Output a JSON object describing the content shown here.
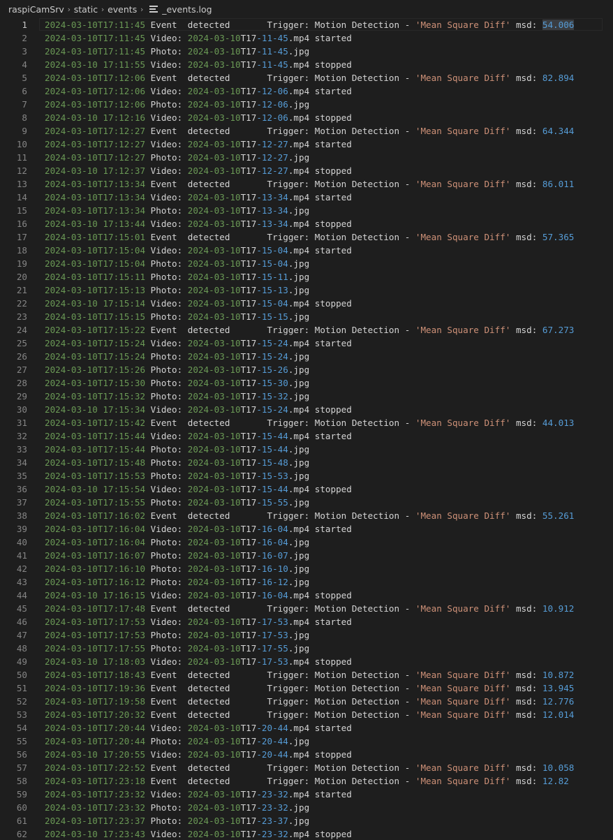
{
  "breadcrumb": {
    "items": [
      "raspiCamSrv",
      "static",
      "events"
    ],
    "file": "_events.log"
  },
  "editor": {
    "active_line": 1,
    "selection_text": "54.006",
    "lines": [
      {
        "n": "1",
        "ts": "2024-03-10T17:11:45",
        "kind": "event",
        "msd": "54.006"
      },
      {
        "n": "2",
        "ts": "2024-03-10T17:11:45",
        "kind": "video",
        "stem": "2024-03-10T17-11-45",
        "status": "started"
      },
      {
        "n": "3",
        "ts": "2024-03-10T17:11:45",
        "kind": "photo",
        "stem": "2024-03-10T17-11-45"
      },
      {
        "n": "4",
        "ts": "2024-03-10 17:11:55",
        "kind": "video",
        "stem": "2024-03-10T17-11-45",
        "status": "stopped"
      },
      {
        "n": "5",
        "ts": "2024-03-10T17:12:06",
        "kind": "event",
        "msd": "82.894"
      },
      {
        "n": "6",
        "ts": "2024-03-10T17:12:06",
        "kind": "video",
        "stem": "2024-03-10T17-12-06",
        "status": "started"
      },
      {
        "n": "7",
        "ts": "2024-03-10T17:12:06",
        "kind": "photo",
        "stem": "2024-03-10T17-12-06"
      },
      {
        "n": "8",
        "ts": "2024-03-10 17:12:16",
        "kind": "video",
        "stem": "2024-03-10T17-12-06",
        "status": "stopped"
      },
      {
        "n": "9",
        "ts": "2024-03-10T17:12:27",
        "kind": "event",
        "msd": "64.344"
      },
      {
        "n": "10",
        "ts": "2024-03-10T17:12:27",
        "kind": "video",
        "stem": "2024-03-10T17-12-27",
        "status": "started"
      },
      {
        "n": "11",
        "ts": "2024-03-10T17:12:27",
        "kind": "photo",
        "stem": "2024-03-10T17-12-27"
      },
      {
        "n": "12",
        "ts": "2024-03-10 17:12:37",
        "kind": "video",
        "stem": "2024-03-10T17-12-27",
        "status": "stopped"
      },
      {
        "n": "13",
        "ts": "2024-03-10T17:13:34",
        "kind": "event",
        "msd": "86.011"
      },
      {
        "n": "14",
        "ts": "2024-03-10T17:13:34",
        "kind": "video",
        "stem": "2024-03-10T17-13-34",
        "status": "started"
      },
      {
        "n": "15",
        "ts": "2024-03-10T17:13:34",
        "kind": "photo",
        "stem": "2024-03-10T17-13-34"
      },
      {
        "n": "16",
        "ts": "2024-03-10 17:13:44",
        "kind": "video",
        "stem": "2024-03-10T17-13-34",
        "status": "stopped"
      },
      {
        "n": "17",
        "ts": "2024-03-10T17:15:01",
        "kind": "event",
        "msd": "57.365"
      },
      {
        "n": "18",
        "ts": "2024-03-10T17:15:04",
        "kind": "video",
        "stem": "2024-03-10T17-15-04",
        "status": "started"
      },
      {
        "n": "19",
        "ts": "2024-03-10T17:15:04",
        "kind": "photo",
        "stem": "2024-03-10T17-15-04"
      },
      {
        "n": "20",
        "ts": "2024-03-10T17:15:11",
        "kind": "photo",
        "stem": "2024-03-10T17-15-11"
      },
      {
        "n": "21",
        "ts": "2024-03-10T17:15:13",
        "kind": "photo",
        "stem": "2024-03-10T17-15-13"
      },
      {
        "n": "22",
        "ts": "2024-03-10 17:15:14",
        "kind": "video",
        "stem": "2024-03-10T17-15-04",
        "status": "stopped"
      },
      {
        "n": "23",
        "ts": "2024-03-10T17:15:15",
        "kind": "photo",
        "stem": "2024-03-10T17-15-15"
      },
      {
        "n": "24",
        "ts": "2024-03-10T17:15:22",
        "kind": "event",
        "msd": "67.273"
      },
      {
        "n": "25",
        "ts": "2024-03-10T17:15:24",
        "kind": "video",
        "stem": "2024-03-10T17-15-24",
        "status": "started"
      },
      {
        "n": "26",
        "ts": "2024-03-10T17:15:24",
        "kind": "photo",
        "stem": "2024-03-10T17-15-24"
      },
      {
        "n": "27",
        "ts": "2024-03-10T17:15:26",
        "kind": "photo",
        "stem": "2024-03-10T17-15-26"
      },
      {
        "n": "28",
        "ts": "2024-03-10T17:15:30",
        "kind": "photo",
        "stem": "2024-03-10T17-15-30"
      },
      {
        "n": "29",
        "ts": "2024-03-10T17:15:32",
        "kind": "photo",
        "stem": "2024-03-10T17-15-32"
      },
      {
        "n": "30",
        "ts": "2024-03-10 17:15:34",
        "kind": "video",
        "stem": "2024-03-10T17-15-24",
        "status": "stopped"
      },
      {
        "n": "31",
        "ts": "2024-03-10T17:15:42",
        "kind": "event",
        "msd": "44.013"
      },
      {
        "n": "32",
        "ts": "2024-03-10T17:15:44",
        "kind": "video",
        "stem": "2024-03-10T17-15-44",
        "status": "started"
      },
      {
        "n": "33",
        "ts": "2024-03-10T17:15:44",
        "kind": "photo",
        "stem": "2024-03-10T17-15-44"
      },
      {
        "n": "34",
        "ts": "2024-03-10T17:15:48",
        "kind": "photo",
        "stem": "2024-03-10T17-15-48"
      },
      {
        "n": "35",
        "ts": "2024-03-10T17:15:53",
        "kind": "photo",
        "stem": "2024-03-10T17-15-53"
      },
      {
        "n": "36",
        "ts": "2024-03-10 17:15:54",
        "kind": "video",
        "stem": "2024-03-10T17-15-44",
        "status": "stopped"
      },
      {
        "n": "37",
        "ts": "2024-03-10T17:15:55",
        "kind": "photo",
        "stem": "2024-03-10T17-15-55"
      },
      {
        "n": "38",
        "ts": "2024-03-10T17:16:02",
        "kind": "event",
        "msd": "55.261"
      },
      {
        "n": "39",
        "ts": "2024-03-10T17:16:04",
        "kind": "video",
        "stem": "2024-03-10T17-16-04",
        "status": "started"
      },
      {
        "n": "40",
        "ts": "2024-03-10T17:16:04",
        "kind": "photo",
        "stem": "2024-03-10T17-16-04"
      },
      {
        "n": "41",
        "ts": "2024-03-10T17:16:07",
        "kind": "photo",
        "stem": "2024-03-10T17-16-07"
      },
      {
        "n": "42",
        "ts": "2024-03-10T17:16:10",
        "kind": "photo",
        "stem": "2024-03-10T17-16-10"
      },
      {
        "n": "43",
        "ts": "2024-03-10T17:16:12",
        "kind": "photo",
        "stem": "2024-03-10T17-16-12"
      },
      {
        "n": "44",
        "ts": "2024-03-10 17:16:15",
        "kind": "video",
        "stem": "2024-03-10T17-16-04",
        "status": "stopped"
      },
      {
        "n": "45",
        "ts": "2024-03-10T17:17:48",
        "kind": "event",
        "msd": "10.912"
      },
      {
        "n": "46",
        "ts": "2024-03-10T17:17:53",
        "kind": "video",
        "stem": "2024-03-10T17-17-53",
        "status": "started"
      },
      {
        "n": "47",
        "ts": "2024-03-10T17:17:53",
        "kind": "photo",
        "stem": "2024-03-10T17-17-53"
      },
      {
        "n": "48",
        "ts": "2024-03-10T17:17:55",
        "kind": "photo",
        "stem": "2024-03-10T17-17-55"
      },
      {
        "n": "49",
        "ts": "2024-03-10 17:18:03",
        "kind": "video",
        "stem": "2024-03-10T17-17-53",
        "status": "stopped"
      },
      {
        "n": "50",
        "ts": "2024-03-10T17:18:43",
        "kind": "event",
        "msd": "10.872"
      },
      {
        "n": "51",
        "ts": "2024-03-10T17:19:36",
        "kind": "event",
        "msd": "13.945"
      },
      {
        "n": "52",
        "ts": "2024-03-10T17:19:58",
        "kind": "event",
        "msd": "12.776"
      },
      {
        "n": "53",
        "ts": "2024-03-10T17:20:32",
        "kind": "event",
        "msd": "12.014"
      },
      {
        "n": "54",
        "ts": "2024-03-10T17:20:44",
        "kind": "video",
        "stem": "2024-03-10T17-20-44",
        "status": "started"
      },
      {
        "n": "55",
        "ts": "2024-03-10T17:20:44",
        "kind": "photo",
        "stem": "2024-03-10T17-20-44"
      },
      {
        "n": "56",
        "ts": "2024-03-10 17:20:55",
        "kind": "video",
        "stem": "2024-03-10T17-20-44",
        "status": "stopped"
      },
      {
        "n": "57",
        "ts": "2024-03-10T17:22:52",
        "kind": "event",
        "msd": "10.058"
      },
      {
        "n": "58",
        "ts": "2024-03-10T17:23:18",
        "kind": "event",
        "msd": "12.82"
      },
      {
        "n": "59",
        "ts": "2024-03-10T17:23:32",
        "kind": "video",
        "stem": "2024-03-10T17-23-32",
        "status": "started"
      },
      {
        "n": "60",
        "ts": "2024-03-10T17:23:32",
        "kind": "photo",
        "stem": "2024-03-10T17-23-32"
      },
      {
        "n": "61",
        "ts": "2024-03-10T17:23:37",
        "kind": "photo",
        "stem": "2024-03-10T17-23-37"
      },
      {
        "n": "62",
        "ts": "2024-03-10 17:23:43",
        "kind": "video",
        "stem": "2024-03-10T17-23-32",
        "status": "stopped"
      }
    ]
  },
  "tokens": {
    "event_word": "Event",
    "detected_word": "detected",
    "trigger_label": "Trigger:",
    "trigger_value": "Motion Detection",
    "dash": "-",
    "method": "'Mean Square Diff'",
    "msd_label": "msd:",
    "video_label": "Video:",
    "photo_label": "Photo:",
    "mp4_ext": ".mp4",
    "jpg_ext": ".jpg"
  }
}
